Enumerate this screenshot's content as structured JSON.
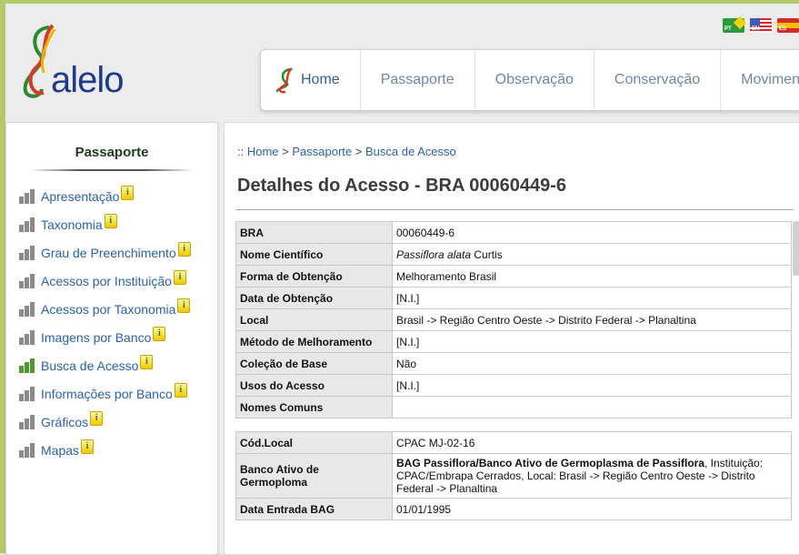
{
  "brand": {
    "name": "alelo"
  },
  "flags": [
    {
      "code": "PT",
      "color": "#2c9a3a",
      "accent": "#f2d200"
    },
    {
      "code": "EN",
      "color": "#3b5cb8",
      "accent": "#d42a2a"
    },
    {
      "code": "ES",
      "color": "#d42a2a",
      "accent": "#f2c200"
    }
  ],
  "nav": {
    "items": [
      {
        "label": "Home"
      },
      {
        "label": "Passaporte"
      },
      {
        "label": "Observação"
      },
      {
        "label": "Conservação"
      },
      {
        "label": "Movimentação"
      }
    ]
  },
  "sidebar": {
    "title": "Passaporte",
    "items": [
      {
        "label": "Apresentação"
      },
      {
        "label": "Taxonomia"
      },
      {
        "label": "Grau de Preenchimento"
      },
      {
        "label": "Acessos por Instituição"
      },
      {
        "label": "Acessos por Taxonomia"
      },
      {
        "label": "Imagens por Banco"
      },
      {
        "label": "Busca de Acesso"
      },
      {
        "label": "Informações por Banco"
      },
      {
        "label": "Gráficos"
      },
      {
        "label": "Mapas"
      }
    ],
    "active_index": 6,
    "info_glyph": "i"
  },
  "breadcrumb": {
    "prefix": "::",
    "items": [
      "Home",
      "Passaporte",
      "Busca de Acesso"
    ],
    "separator": ">"
  },
  "page": {
    "title": "Detalhes do Acesso - BRA 00060449-6"
  },
  "details": {
    "rows": [
      {
        "label": "BRA",
        "value": "00060449-6"
      },
      {
        "label": "Nome Científico",
        "value_italic": "Passiflora alata",
        "value": " Curtis"
      },
      {
        "label": "Forma de Obtenção",
        "value": "Melhoramento Brasil"
      },
      {
        "label": "Data de Obtenção",
        "value": "[N.I.]"
      },
      {
        "label": "Local",
        "value": "Brasil -> Região Centro Oeste -> Distrito Federal -> Planaltina"
      },
      {
        "label": "Método de Melhoramento",
        "value": "[N.I.]"
      },
      {
        "label": "Coleção de Base",
        "value": "Não"
      },
      {
        "label": "Usos do Acesso",
        "value": "[N.I.]"
      },
      {
        "label": "Nomes Comuns",
        "value": ""
      }
    ],
    "rows2": [
      {
        "label": "Cód.Local",
        "value": "CPAC MJ-02-16"
      },
      {
        "label": "Banco Ativo de Germoploma",
        "value_bold": "BAG Passiflora/Banco Ativo de Germoplasma de Passiflora",
        "value": ", Instituição: CPAC/Embrapa Cerrados, Local: Brasil -> Região Centro Oeste -> Distrito Federal -> Planaltina"
      },
      {
        "label": "Data Entrada BAG",
        "value": "01/01/1995"
      }
    ]
  }
}
